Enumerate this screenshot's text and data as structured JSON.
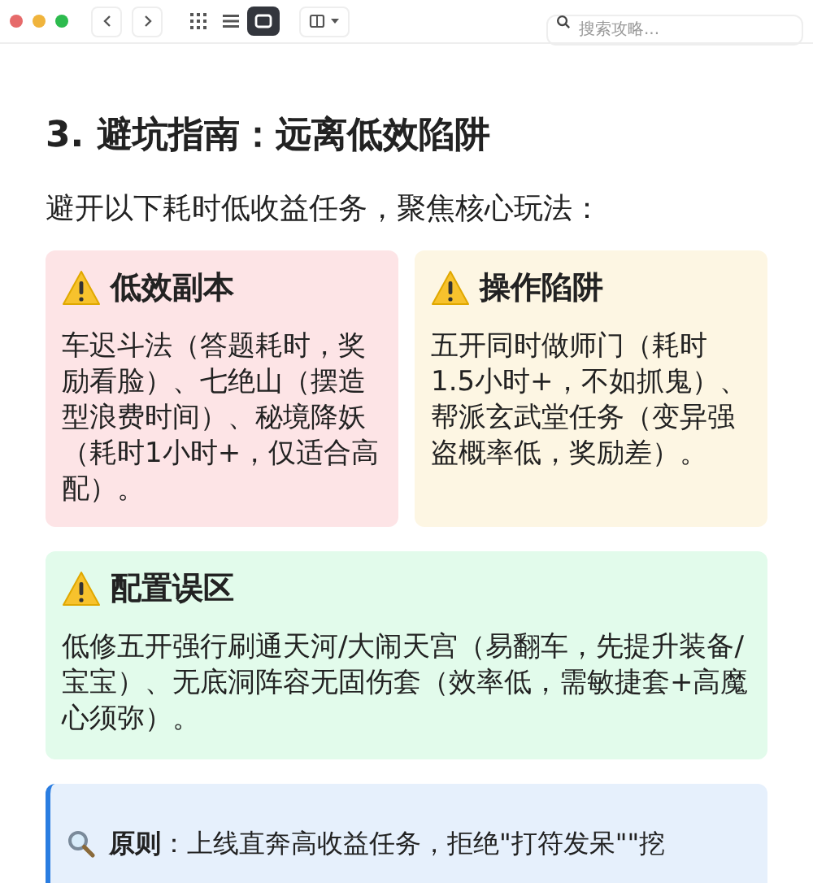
{
  "toolbar": {
    "views": [
      {
        "kind": "grid",
        "selected": false
      },
      {
        "kind": "list",
        "selected": false
      },
      {
        "kind": "card",
        "selected": true
      }
    ],
    "search": {
      "placeholder": "搜索攻略..."
    }
  },
  "heading": "3. 避坑指南：远离低效陷阱",
  "intro": "避开以下耗时低收益任务，聚焦核心玩法：",
  "cards": [
    {
      "title": "低效副本",
      "text": "车迟斗法（答题耗时，奖励看脸）、七绝山（摆造型浪费时间）、秘境降妖（耗时1小时+，仅适合高配）。",
      "color": "#fde4e6",
      "wide": false
    },
    {
      "title": "操作陷阱",
      "text": "五开同时做师门（耗时1.5小时+，不如抓鬼）、帮派玄武堂任务（变异强盗概率低，奖励差）。",
      "color": "#fdf6e3",
      "wide": false
    },
    {
      "title": "配置误区",
      "text": "低修五开强行刷通天河/大闹天宫（易翻车，先提升装备/宝宝）、无底洞阵容无固伤套（效率低，需敏捷套+高魔心须弥）。",
      "color": "#e2fbeb",
      "wide": true
    }
  ],
  "note": {
    "text": "**原则**：上线直奔高收益任务，拒绝\"打符发呆\"\"挖"
  }
}
